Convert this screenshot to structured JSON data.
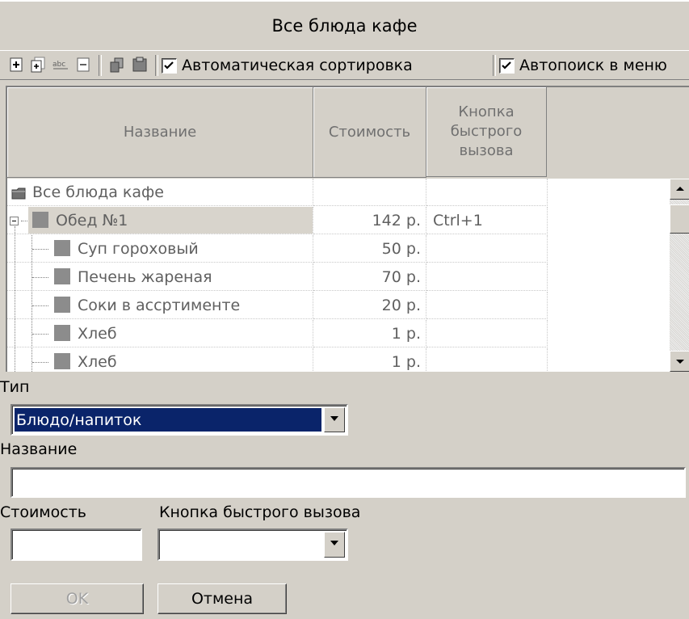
{
  "window": {
    "title": "Все блюда кафе"
  },
  "toolbar": {
    "icons": [
      "add-item-icon",
      "add-subitem-icon",
      "rename-icon",
      "delete-icon",
      "copy-icon",
      "paste-icon"
    ],
    "auto_sort_label": "Автоматическая сортировка",
    "auto_sort_checked": true,
    "auto_search_label": "Автопоиск в меню",
    "auto_search_checked": true
  },
  "grid": {
    "columns": [
      "Название",
      "Стоимость",
      "Кнопка быстрого вызова"
    ],
    "rows": [
      {
        "name": "Все блюда кафе",
        "price": "",
        "hotkey": "",
        "kind": "folder",
        "level": 0
      },
      {
        "name": "Обед №1",
        "price": "142 р.",
        "hotkey": "Ctrl+1",
        "kind": "item",
        "level": 1,
        "selected": true
      },
      {
        "name": "Суп гороховый",
        "price": "50 р.",
        "hotkey": "",
        "kind": "item",
        "level": 2
      },
      {
        "name": "Печень жареная",
        "price": "70 р.",
        "hotkey": "",
        "kind": "item",
        "level": 2
      },
      {
        "name": "Соки в ассртименте",
        "price": "20 р.",
        "hotkey": "",
        "kind": "item",
        "level": 2
      },
      {
        "name": "Хлеб",
        "price": "1 р.",
        "hotkey": "",
        "kind": "item",
        "level": 2
      },
      {
        "name": "Хлеб",
        "price": "1 р.",
        "hotkey": "",
        "kind": "item",
        "level": 2
      }
    ]
  },
  "form": {
    "type_label": "Тип",
    "type_value": "Блюдо/напиток",
    "name_label": "Название",
    "name_value": "",
    "price_label": "Стоимость",
    "price_value": "",
    "hotkey_label": "Кнопка быстрого вызова",
    "hotkey_value": ""
  },
  "buttons": {
    "ok_label": "OK",
    "cancel_label": "Отмена"
  },
  "colors": {
    "selection": "#0a246a",
    "face": "#d4d0c8"
  }
}
